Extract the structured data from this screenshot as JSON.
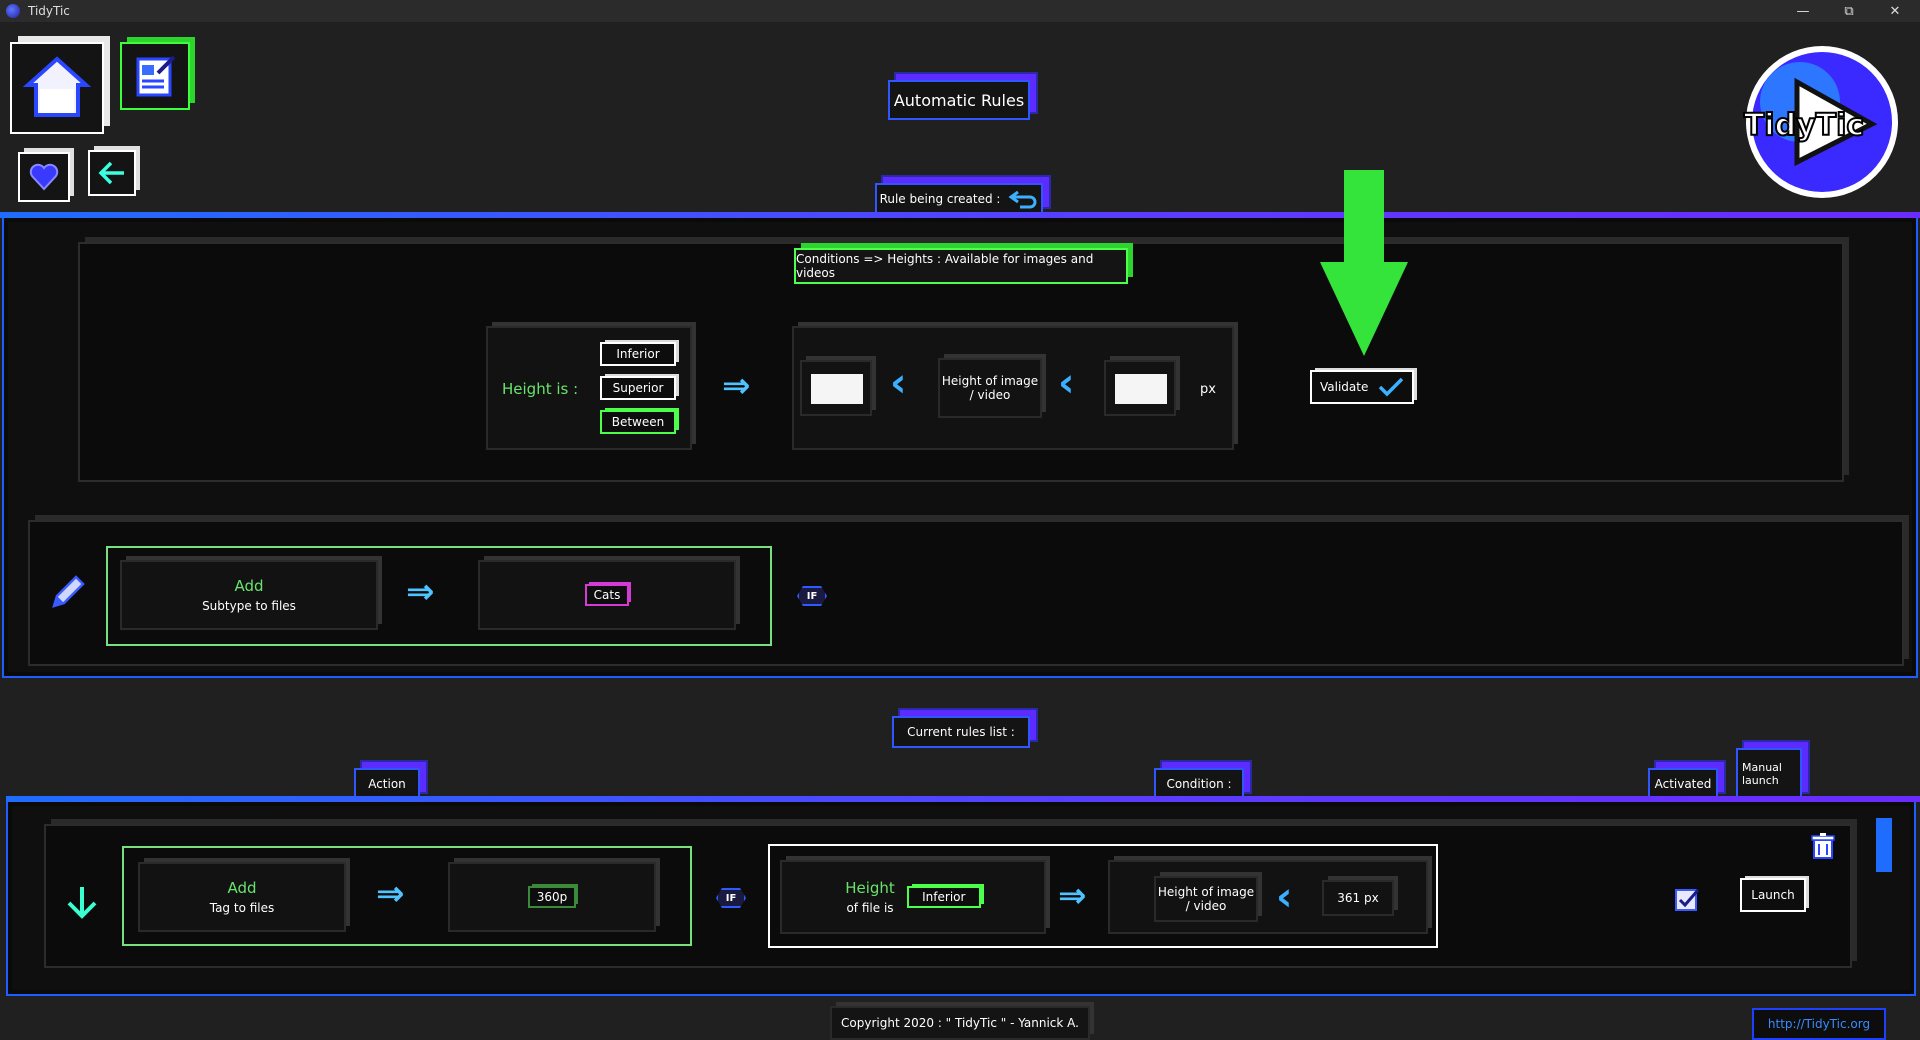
{
  "window": {
    "title": "TidyTic",
    "minimize": "—",
    "restore": "⧉",
    "close": "✕"
  },
  "header": {
    "title": "Automatic Rules",
    "logo_text": "TidyTic"
  },
  "rule_being_created": {
    "label": "Rule being created :",
    "conditions_title": "Conditions => Heights : Available for images and videos",
    "height_is": "Height is :",
    "options": [
      "Inferior",
      "Superior",
      "Between"
    ],
    "selected_option": "Between",
    "height_of": "Height of image / video",
    "unit": "px",
    "validate": "Validate"
  },
  "action_row": {
    "add": "Add",
    "subtype": "Subtype to files",
    "value": "Cats",
    "if": "IF"
  },
  "current_rules": {
    "label": "Current rules list :",
    "col_action": "Action",
    "col_condition": "Condition :",
    "col_activated": "Activated",
    "col_manual": "Manual launch",
    "rule": {
      "add": "Add",
      "tag": "Tag to files",
      "value": "360p",
      "if": "IF",
      "height": "Height",
      "of_file_is": "of file is",
      "cond_option": "Inferior",
      "height_of": "Height of image / video",
      "threshold": "361 px",
      "activated": true,
      "launch": "Launch"
    }
  },
  "footer": {
    "copyright": "Copyright 2020 : \" TidyTic \" - Yannick A.",
    "url": "http://TidyTic.org"
  }
}
